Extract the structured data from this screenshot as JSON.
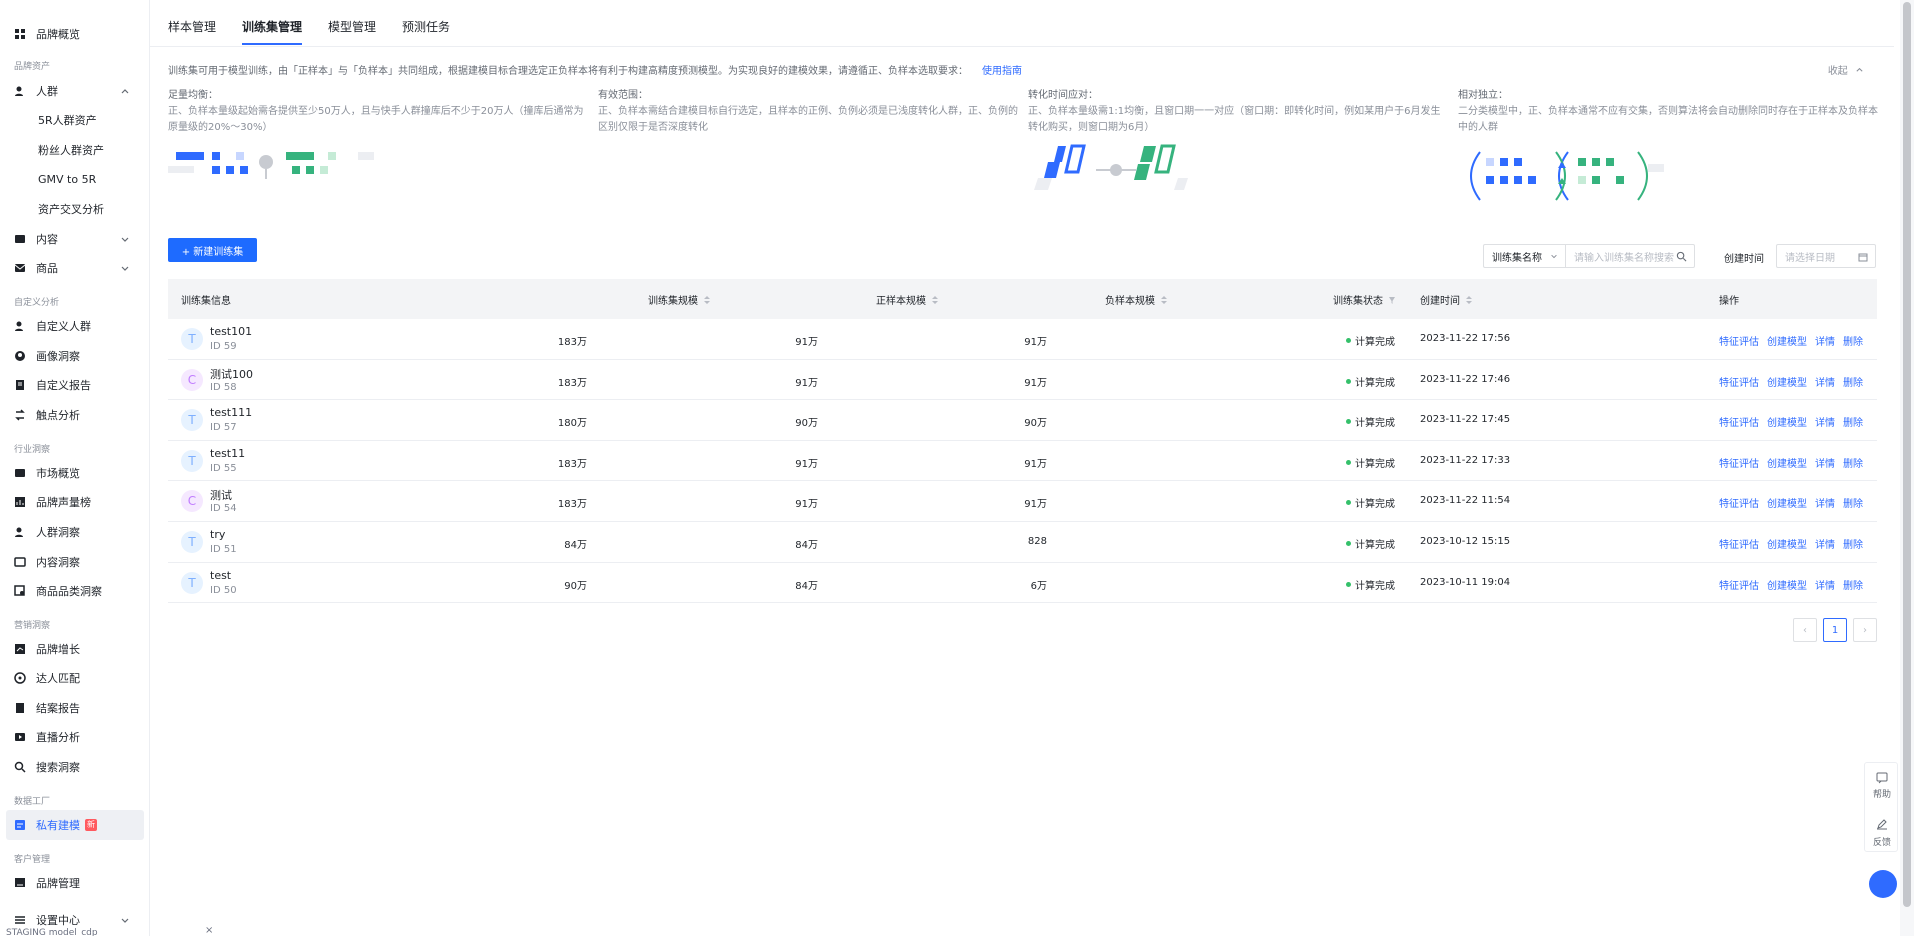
{
  "sidebar": {
    "items": [
      {
        "label": "品牌概览",
        "type": "item"
      },
      {
        "label": "品牌资产",
        "type": "group"
      },
      {
        "label": "人群",
        "type": "item"
      },
      {
        "label": "5R人群资产",
        "type": "sub"
      },
      {
        "label": "粉丝人群资产",
        "type": "sub"
      },
      {
        "label": "GMV to 5R",
        "type": "sub"
      },
      {
        "label": "资产交叉分析",
        "type": "sub"
      },
      {
        "label": "内容",
        "type": "item"
      },
      {
        "label": "商品",
        "type": "item"
      },
      {
        "label": "自定义分析",
        "type": "group"
      },
      {
        "label": "自定义人群",
        "type": "item"
      },
      {
        "label": "画像洞察",
        "type": "item"
      },
      {
        "label": "自定义报告",
        "type": "item"
      },
      {
        "label": "触点分析",
        "type": "item"
      },
      {
        "label": "行业洞察",
        "type": "group"
      },
      {
        "label": "市场概览",
        "type": "item"
      },
      {
        "label": "品牌声量榜",
        "type": "item"
      },
      {
        "label": "人群洞察",
        "type": "item"
      },
      {
        "label": "内容洞察",
        "type": "item"
      },
      {
        "label": "商品品类洞察",
        "type": "item"
      },
      {
        "label": "营销洞察",
        "type": "group"
      },
      {
        "label": "品牌增长",
        "type": "item"
      },
      {
        "label": "达人匹配",
        "type": "item"
      },
      {
        "label": "结案报告",
        "type": "item"
      },
      {
        "label": "直播分析",
        "type": "item"
      },
      {
        "label": "搜索洞察",
        "type": "item"
      },
      {
        "label": "数据工厂",
        "type": "group"
      },
      {
        "label": "私有建模",
        "type": "item",
        "badge": "新"
      },
      {
        "label": "客户管理",
        "type": "group"
      },
      {
        "label": "品牌管理",
        "type": "item"
      },
      {
        "label": "设置中心",
        "type": "item"
      }
    ],
    "env_text": "STAGING model_cdp",
    "env_close": "×"
  },
  "tabs": [
    "样本管理",
    "训练集管理",
    "模型管理",
    "预测任务"
  ],
  "intro": {
    "text": "训练集可用于模型训练，由「正样本」与「负样本」共同组成，根据建模目标合理选定正负样本将有利于构建高精度预测模型。为实现良好的建模效果，请遵循正、负样本选取要求：",
    "guide": "使用指南",
    "collapse": "收起"
  },
  "cards": [
    {
      "title": "足量均衡：",
      "text": "正、负样本量级起始需各提供至少50万人，且与快手人群撞库后不少于20万人（撞库后通常为原量级的20%～30%）"
    },
    {
      "title": "有效范围：",
      "text": "正、负样本需结合建模目标自行选定，且样本的正例、负例必须是已浅度转化人群，正、负例的区别仅限于是否深度转化"
    },
    {
      "title": "转化时间应对：",
      "text": "正、负样本量级需1:1均衡，且窗口期一一对应（窗口期：即转化时间，例如某用户于6月发生转化购买，则窗口期为6月）"
    },
    {
      "title": "相对独立：",
      "text": "二分类模型中，正、负样本通常不应有交集，否则算法将会自动删除同时存在于正样本及负样本中的人群"
    }
  ],
  "toolbar": {
    "new_button": "+ 新建训练集",
    "filter_select": "训练集名称",
    "search_placeholder": "请输入训练集名称搜索",
    "date_label": "创建时间",
    "date_placeholder": "请选择日期"
  },
  "table": {
    "headers": [
      "训练集信息",
      "训练集规模",
      "正样本规模",
      "负样本规模",
      "训练集状态",
      "创建时间",
      "操作"
    ],
    "rows": [
      {
        "avatar": "T",
        "name": "test101",
        "id": "ID 59",
        "size": "183万",
        "pos": "91万",
        "neg": "91万",
        "status": "计算完成",
        "time": "2023-11-22 17:56"
      },
      {
        "avatar": "C",
        "name": "测试100",
        "id": "ID 58",
        "size": "183万",
        "pos": "91万",
        "neg": "91万",
        "status": "计算完成",
        "time": "2023-11-22 17:46"
      },
      {
        "avatar": "T",
        "name": "test111",
        "id": "ID 57",
        "size": "180万",
        "pos": "90万",
        "neg": "90万",
        "status": "计算完成",
        "time": "2023-11-22 17:45"
      },
      {
        "avatar": "T",
        "name": "test11",
        "id": "ID 55",
        "size": "183万",
        "pos": "91万",
        "neg": "91万",
        "status": "计算完成",
        "time": "2023-11-22 17:33"
      },
      {
        "avatar": "C",
        "name": "测试",
        "id": "ID 54",
        "size": "183万",
        "pos": "91万",
        "neg": "91万",
        "status": "计算完成",
        "time": "2023-11-22 11:54"
      },
      {
        "avatar": "T",
        "name": "try",
        "id": "ID 51",
        "size": "84万",
        "pos": "84万",
        "neg": "828",
        "status": "计算完成",
        "time": "2023-10-12 15:15"
      },
      {
        "avatar": "T",
        "name": "test",
        "id": "ID 50",
        "size": "90万",
        "pos": "84万",
        "neg": "6万",
        "status": "计算完成",
        "time": "2023-10-11 19:04"
      }
    ],
    "ops": [
      "特征评估",
      "创建模型",
      "详情",
      "删除"
    ]
  },
  "pager": {
    "prev": "‹",
    "current": "1",
    "next": "›"
  },
  "float": {
    "help": "帮助",
    "feedback": "反馈"
  },
  "colors": {
    "accent": "#2f6bff",
    "success": "#34c06a"
  }
}
